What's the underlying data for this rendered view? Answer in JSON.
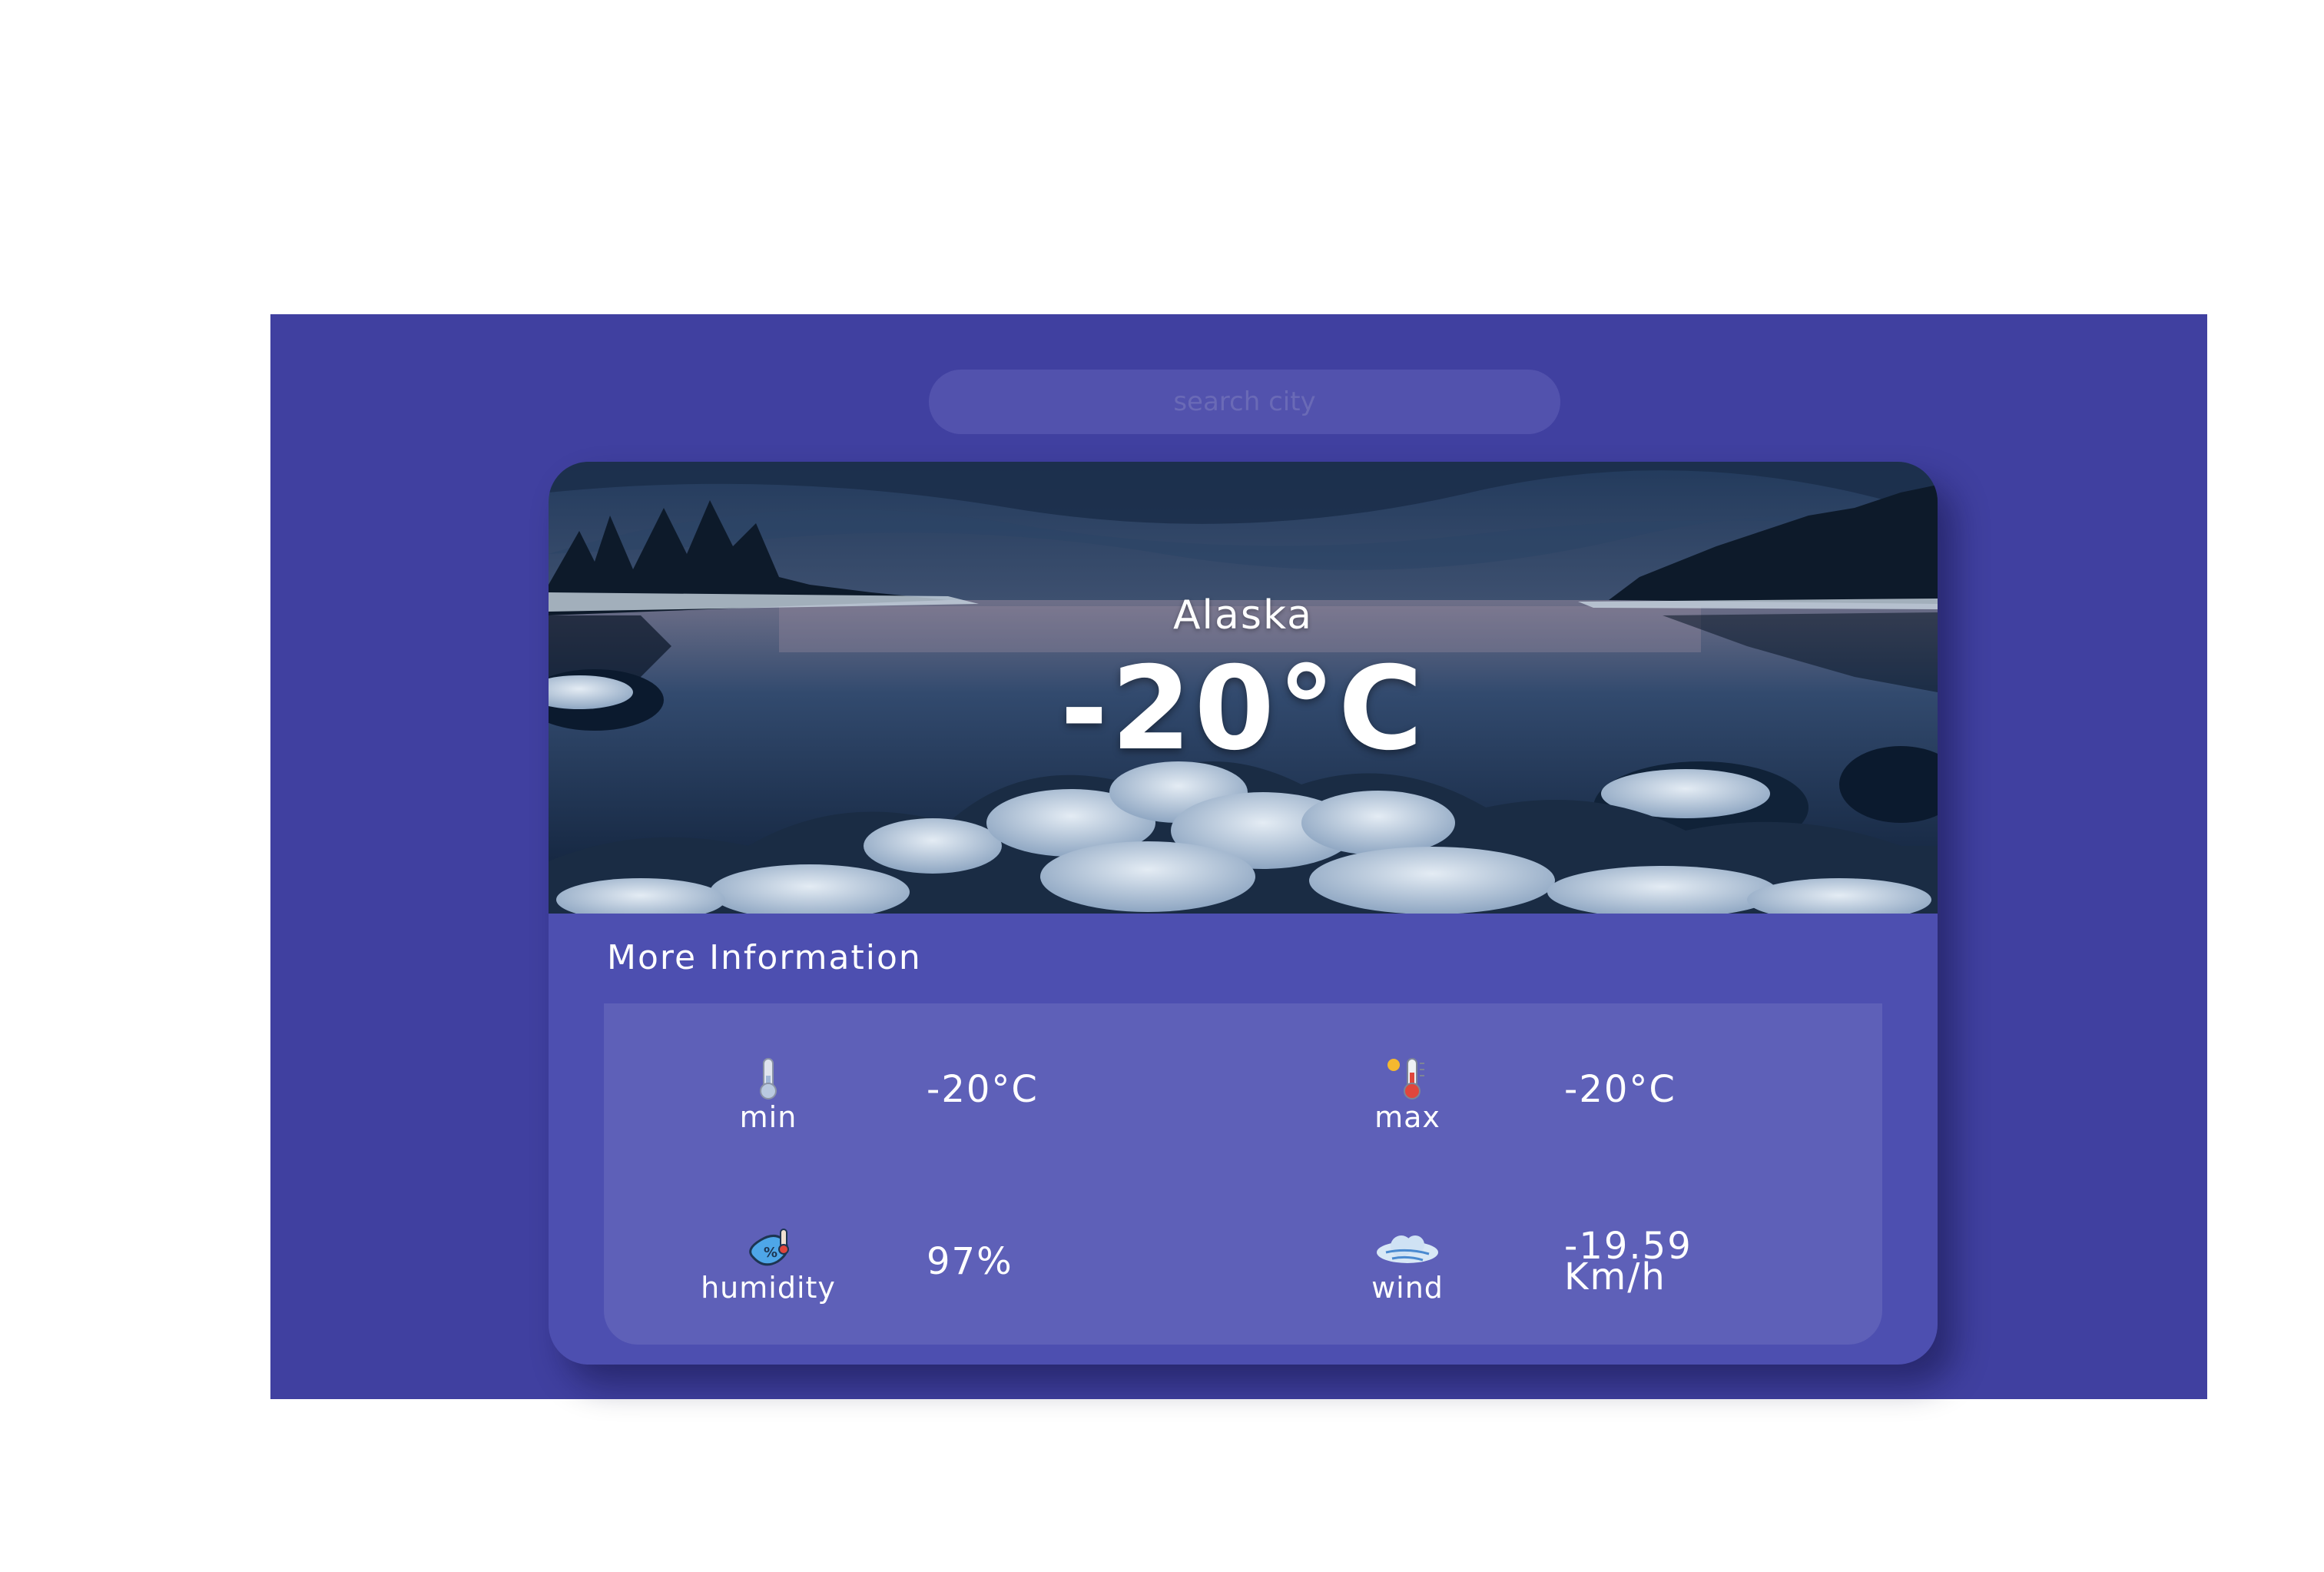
{
  "search": {
    "placeholder": "search city"
  },
  "weather": {
    "city": "Alaska",
    "temperature": "-20°C"
  },
  "details": {
    "title": "More Information",
    "min": {
      "label": "min",
      "value": "-20°C",
      "icon": "thermometer-low-icon"
    },
    "max": {
      "label": "max",
      "value": "-20°C",
      "icon": "thermometer-sun-icon"
    },
    "humidity": {
      "label": "humidity",
      "value": "97%",
      "icon": "humidity-icon"
    },
    "wind": {
      "label": "wind",
      "value": "-19.59",
      "unit": "Km/h",
      "icon": "wind-cloud-icon"
    }
  },
  "colors": {
    "background": "#4040a0",
    "card": "#4d4fb0",
    "panel": "#5e60b8",
    "search": "#5252ad"
  }
}
